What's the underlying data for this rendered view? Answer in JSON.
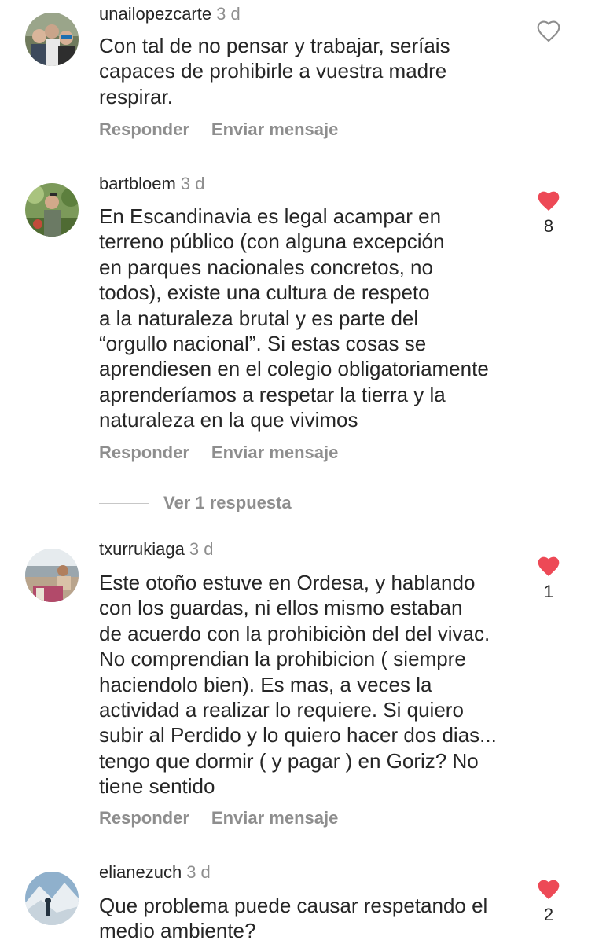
{
  "comments": [
    {
      "username": "unailopezcarte",
      "time": "3 d",
      "lines": [
        "Con tal de no pensar y trabajar, seríais",
        "capaces de prohibirle a vuestra madre",
        "respirar."
      ],
      "reply_label": "Responder",
      "message_label": "Enviar mensaje",
      "liked": false,
      "likes": ""
    },
    {
      "username": "bartbloem",
      "time": "3 d",
      "lines": [
        "En Escandinavia es legal acampar en",
        "terreno público (con alguna excepción",
        "en parques nacionales concretos, no",
        "todos), existe una cultura de respeto",
        "a la naturaleza brutal y es parte del",
        "“orgullo nacional”. Si estas cosas se",
        "aprendiesen en el colegio obligatoriamente",
        "aprenderíamos a respetar la tierra y la",
        "naturaleza en la que vivimos"
      ],
      "reply_label": "Responder",
      "message_label": "Enviar mensaje",
      "liked": true,
      "likes": "8",
      "view_replies": "Ver 1 respuesta"
    },
    {
      "username": "txurrukiaga",
      "time": "3 d",
      "lines": [
        "Este otoño estuve en Ordesa, y hablando",
        "con los guardas, ni ellos mismo estaban",
        "de acuerdo con la prohibiciòn del del vivac.",
        "No comprendian la prohibicion ( siempre",
        "haciendolo bien). Es mas, a veces la",
        "actividad a realizar lo requiere. Si quiero",
        "subir al Perdido y lo quiero hacer dos dias...",
        "tengo que dormir ( y pagar ) en Goriz? No",
        "tiene sentido"
      ],
      "reply_label": "Responder",
      "message_label": "Enviar mensaje",
      "liked": true,
      "likes": "1"
    },
    {
      "username": "elianezuch",
      "time": "3 d",
      "lines": [
        "Que problema puede causar respetando el",
        "medio ambiente?"
      ],
      "liked": true,
      "likes": "2"
    }
  ],
  "colors": {
    "like_red": "#ed4956",
    "muted": "#8e8e8e",
    "text": "#262626"
  },
  "icons": {
    "unliked": "heart-outline-icon",
    "liked": "heart-filled-icon"
  }
}
